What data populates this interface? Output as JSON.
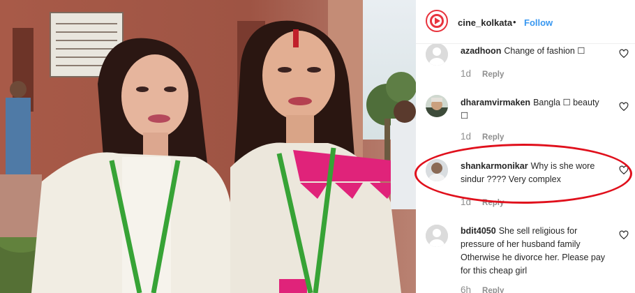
{
  "post": {
    "username": "cine_kolkata",
    "separator": "•",
    "follow_label": "Follow"
  },
  "comments": [
    {
      "user": "azadhoon",
      "text": "Change of fashion ☐",
      "time": "1d",
      "reply": "Reply"
    },
    {
      "user": "dharamvirmaken",
      "text": "Bangla ☐ beauty ☐",
      "time": "1d",
      "reply": "Reply"
    },
    {
      "user": "shankarmonikar",
      "text": "Why is she wore sindur ???? Very complex",
      "time": "1d",
      "reply": "Reply"
    },
    {
      "user": "bdit4050",
      "text": "She sell religious for pressure of her husband family Otherwise he divorce her. Please pay for this cheap girl",
      "time": "6h",
      "reply": "Reply"
    }
  ],
  "colors": {
    "accent": "#3897f0",
    "highlight": "#e0101c",
    "brand": "#e8333d"
  },
  "icons": {
    "like": "heart-outline-icon",
    "logo": "play-logo-icon"
  }
}
